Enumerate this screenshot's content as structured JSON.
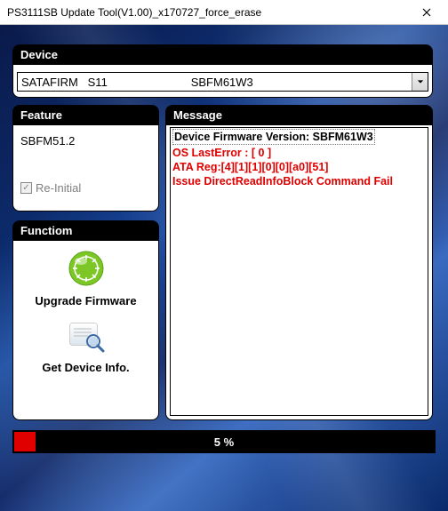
{
  "window": {
    "title": "PS3111SB Update Tool(V1.00)_x170727_force_erase"
  },
  "device": {
    "header": "Device",
    "selected": "SATAFIRM   S11                          SBFM61W3"
  },
  "feature": {
    "header": "Feature",
    "version": "SBFM51.2",
    "reinitial": "Re-Initial"
  },
  "functiom": {
    "header": "Functiom",
    "upgrade": "Upgrade Firmware",
    "getinfo": "Get Device Info."
  },
  "message": {
    "header": "Message",
    "line1": "Device Firmware Version: SBFM61W3",
    "line2": " ",
    "line3": "OS LastError : [ 0 ]",
    "line4": "ATA Reg:[4][1][1][0][0][a0][51]",
    "line5": "Issue DirectReadInfoBlock Command Fail"
  },
  "progress": {
    "text": "5 %",
    "percent": 5
  }
}
